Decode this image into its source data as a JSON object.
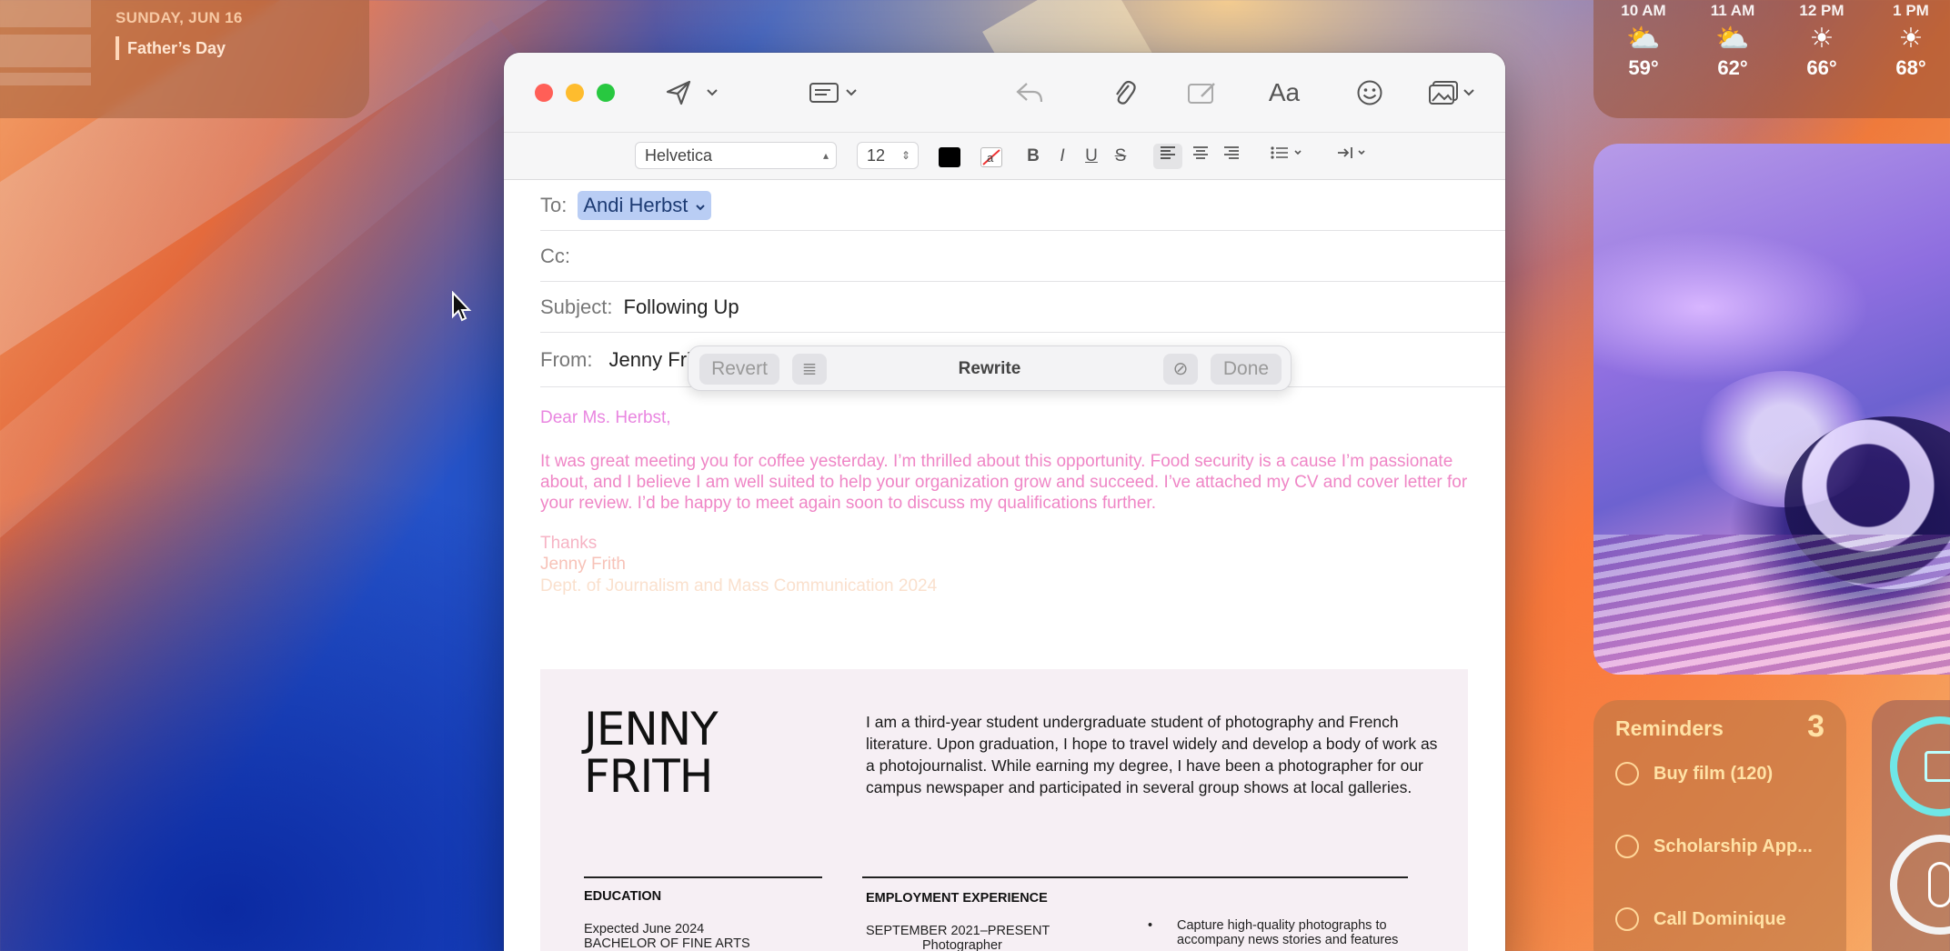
{
  "calendar": {
    "date": "SUNDAY, JUN 16",
    "event": "Father’s Day"
  },
  "weather": [
    {
      "time": "10 AM",
      "icon": "partly-cloudy-icon",
      "temp": "59°"
    },
    {
      "time": "11 AM",
      "icon": "partly-cloudy-icon",
      "temp": "62°"
    },
    {
      "time": "12 PM",
      "icon": "sun-icon",
      "temp": "66°"
    },
    {
      "time": "1 PM",
      "icon": "sun-icon",
      "temp": "68°"
    }
  ],
  "reminders": {
    "title": "Reminders",
    "count": "3",
    "items": [
      "Buy film (120)",
      "Scholarship App...",
      "Call Dominique"
    ]
  },
  "format": {
    "font": "Helvetica",
    "size": "12",
    "bold": "B",
    "italic": "I",
    "underline": "U",
    "strike": "S"
  },
  "fields": {
    "to_label": "To:",
    "to_value": "Andi Herbst",
    "cc_label": "Cc:",
    "subject_label": "Subject:",
    "subject_value": "Following Up",
    "from_label": "From:",
    "from_value": "Jenny Fri"
  },
  "rewrite": {
    "revert": "Revert",
    "title": "Rewrite",
    "done": "Done"
  },
  "body": {
    "greeting": "Dear Ms. Herbst,",
    "paragraph": "It was great meeting you for coffee yesterday. I’m thrilled about this opportunity. Food security is a cause I’m passionate about, and I believe I am well suited to help your organization grow and succeed. I’ve attached my CV and cover letter for your review. I’d be happy to meet again soon to discuss my qualifications further.",
    "closing": "Thanks",
    "sig_name": "Jenny Frith",
    "sig_dept": "Dept. of Journalism and Mass Communication 2024"
  },
  "resume": {
    "name_line1": "JENNY",
    "name_line2": "FRITH",
    "bio": "I am a third-year student undergraduate student of photography and French literature. Upon graduation, I hope to travel widely and develop a body of work as a photojournalist. While earning my degree, I have been a photographer for our campus newspaper and participated in several group shows at local galleries.",
    "education_head": "EDUCATION",
    "edu_date": "Expected June 2024",
    "edu_degree": "BACHELOR OF FINE ARTS",
    "employment_head": "EMPLOYMENT EXPERIENCE",
    "emp_date": "SEPTEMBER 2021–PRESENT",
    "emp_role": "Photographer",
    "emp_bullet_line1": "Capture high-quality photographs to",
    "emp_bullet_line2": "accompany news stories and features"
  },
  "colors": {
    "greeting": "#e986e0",
    "paragraph": "#ef86c6",
    "closing": "#f6b3c4",
    "sig_name": "#f7c2b8",
    "sig_dept": "#fae0cd"
  }
}
